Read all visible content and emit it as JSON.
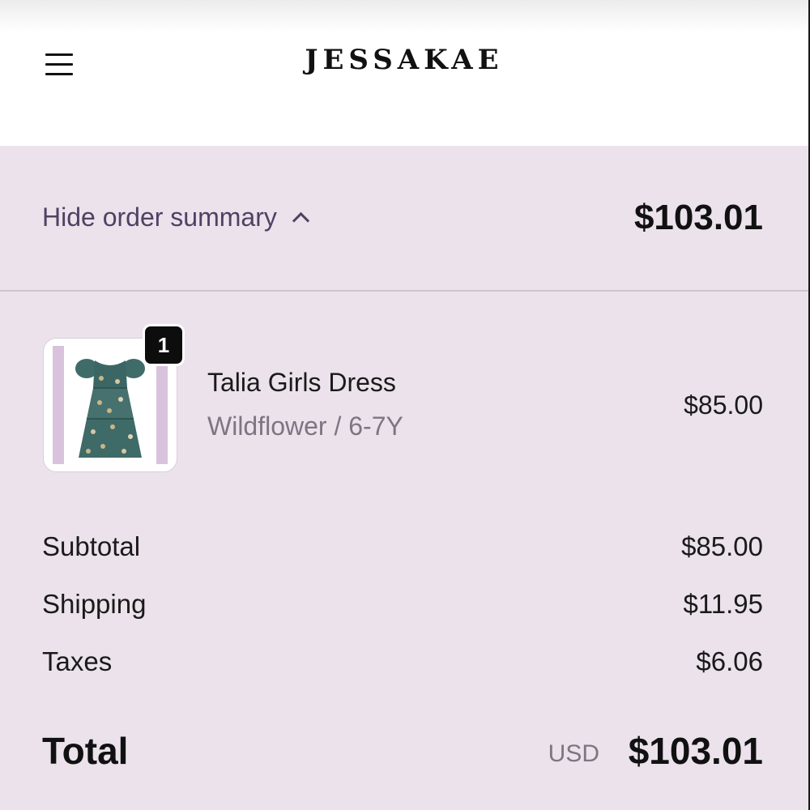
{
  "header": {
    "brand": "JESSAKAE",
    "menu_icon": "hamburger-menu-icon"
  },
  "order_summary": {
    "toggle_label": "Hide order summary",
    "toggle_icon": "chevron-up-icon",
    "header_total": "$103.01"
  },
  "line_items": [
    {
      "name": "Talia Girls Dress",
      "variant": "Wildflower / 6-7Y",
      "price": "$85.00",
      "quantity": "1",
      "image_icon": "dress-thumbnail"
    }
  ],
  "totals": {
    "subtotal_label": "Subtotal",
    "subtotal_value": "$85.00",
    "shipping_label": "Shipping",
    "shipping_value": "$11.95",
    "taxes_label": "Taxes",
    "taxes_value": "$6.06",
    "total_label": "Total",
    "currency": "USD",
    "total_value": "$103.01"
  },
  "colors": {
    "panel_bg": "#ebe2ec",
    "accent_text": "#4e4263",
    "muted_text": "#7d7582"
  }
}
